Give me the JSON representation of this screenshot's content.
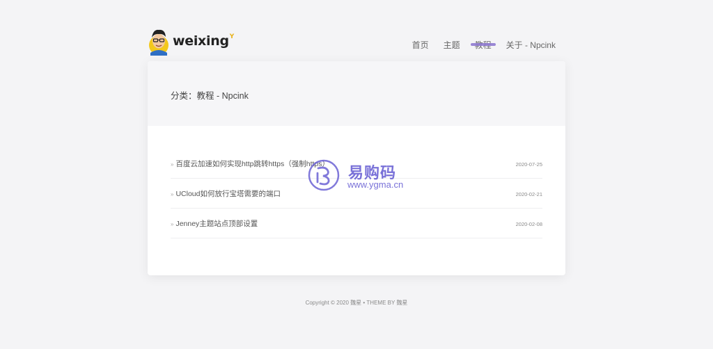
{
  "brand": {
    "name": "weixing",
    "sup": "Y"
  },
  "nav": [
    {
      "label": "首页"
    },
    {
      "label": "主题"
    },
    {
      "label": "教程"
    },
    {
      "label": "关于 - Npcink"
    }
  ],
  "page": {
    "title": "分类：教程 - Npcink"
  },
  "posts": [
    {
      "title": "百度云加速如何实现http跳转https（强制https）",
      "date": "2020-07-25"
    },
    {
      "title": "UCloud如何放行宝塔需要的端口",
      "date": "2020-02-21"
    },
    {
      "title": "Jenney主题站点顶部设置",
      "date": "2020-02-08"
    }
  ],
  "footer": {
    "text": "Copyright © 2020 魏星 • THEME BY 魏星"
  },
  "watermark": {
    "cn": "易购码",
    "url": "www.ygma.cn"
  },
  "colors": {
    "accent": "#8f7ad0",
    "watermark": "#6b62d4",
    "brand_sup": "#e8b21a"
  }
}
